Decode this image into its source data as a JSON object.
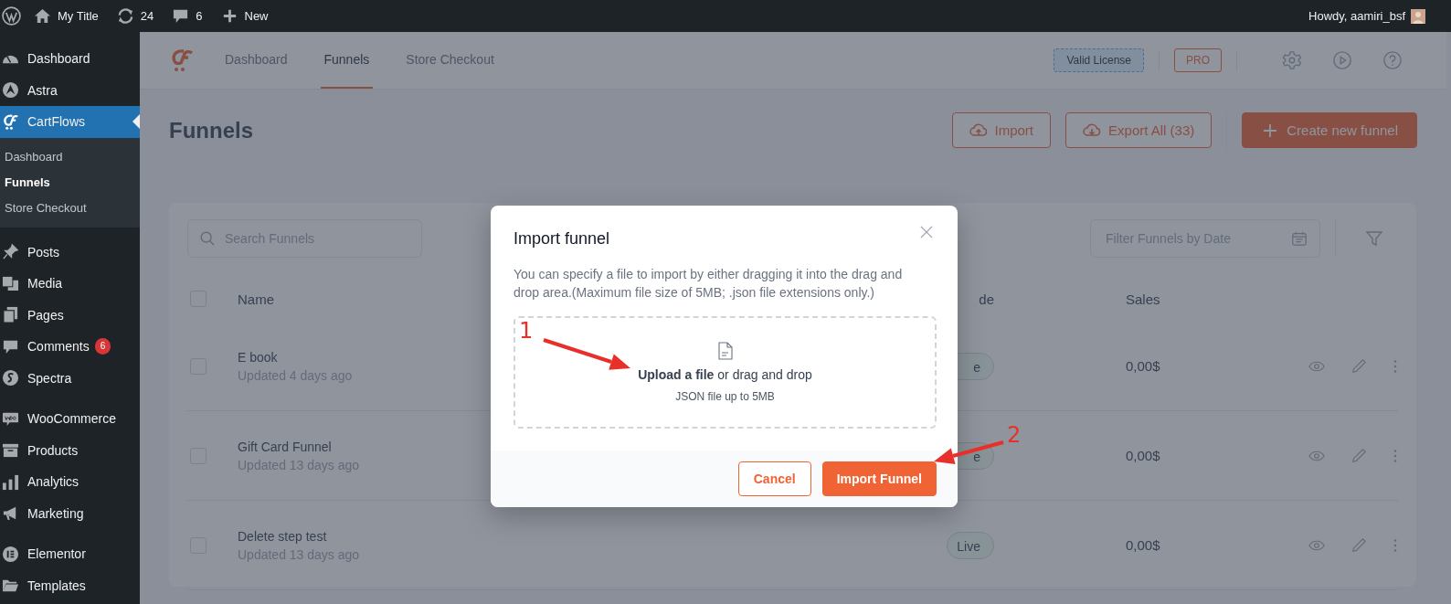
{
  "admin_bar": {
    "site_title": "My Title",
    "updates": "24",
    "comments": "6",
    "new": "New",
    "greeting": "Howdy, aamiri_bsf"
  },
  "sidebar": {
    "groups": [
      [
        {
          "label": "Dashboard",
          "selected": false
        },
        {
          "label": "Astra",
          "selected": false
        },
        {
          "label": "CartFlows",
          "selected": true,
          "children": [
            {
              "label": "Dashboard",
              "selected": false
            },
            {
              "label": "Funnels",
              "selected": true
            },
            {
              "label": "Store Checkout",
              "selected": false
            }
          ]
        }
      ],
      [
        {
          "label": "Posts",
          "selected": false
        },
        {
          "label": "Media",
          "selected": false
        },
        {
          "label": "Pages",
          "selected": false
        },
        {
          "label": "Comments",
          "selected": false,
          "badge": "6"
        },
        {
          "label": "Spectra",
          "selected": false
        }
      ],
      [
        {
          "label": "WooCommerce",
          "selected": false
        },
        {
          "label": "Products",
          "selected": false
        },
        {
          "label": "Analytics",
          "selected": false
        },
        {
          "label": "Marketing",
          "selected": false
        }
      ],
      [
        {
          "label": "Elementor",
          "selected": false
        },
        {
          "label": "Templates",
          "selected": false
        }
      ]
    ]
  },
  "header": {
    "tabs": [
      {
        "label": "Dashboard",
        "selected": false
      },
      {
        "label": "Funnels",
        "selected": true
      },
      {
        "label": "Store Checkout",
        "selected": false
      }
    ],
    "license": "Valid License",
    "plan": "PRO"
  },
  "page": {
    "title": "Funnels",
    "buttons": [
      {
        "label": "Import",
        "kind": "import"
      },
      {
        "label": "Export All (33)",
        "kind": "export"
      },
      {
        "label": "Create new funnel",
        "kind": "create"
      }
    ]
  },
  "table": {
    "select_all": {
      "checked": false
    },
    "search": {
      "placeholder": "Search Funnels"
    },
    "date_filter": {
      "placeholder": "Filter Funnels by Date"
    },
    "columns": [
      "Name",
      "de",
      "Sales"
    ],
    "rows": [
      {
        "name": "E book",
        "updated": "Updated 4 days ago",
        "mode": "e",
        "sales": "0,00$",
        "checked": false
      },
      {
        "name": "Gift Card Funnel",
        "updated": "Updated 13 days ago",
        "mode": "e",
        "sales": "0,00$",
        "checked": false
      },
      {
        "name": "Delete step test",
        "updated": "Updated 13 days ago",
        "mode": "Live",
        "sales": "0,00$",
        "checked": false
      }
    ]
  },
  "modal": {
    "title": "Import funnel",
    "description": "You can specify a file to import by either dragging it into the drag and drop area.(Maximum file size of 5MB; .json file extensions only.)",
    "upload": "**Upload a file** or drag and drop",
    "hint": "JSON file up to 5MB",
    "buttons": [
      {
        "label": "Cancel",
        "kind": "secondary"
      },
      {
        "label": "Import Funnel",
        "kind": "primary"
      }
    ]
  },
  "annotations": [
    {
      "label": "1"
    },
    {
      "label": "2"
    }
  ]
}
